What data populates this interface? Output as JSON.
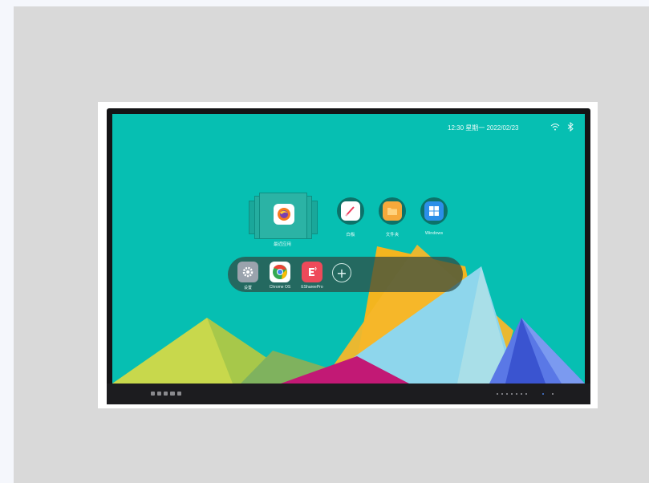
{
  "status_bar": {
    "clock": "12:30  星期一 2022/02/23",
    "icons": [
      "wifi-icon",
      "bluetooth-icon"
    ]
  },
  "apps": {
    "recent_label": "最近应用",
    "recent_app_icon": "firefox-icon",
    "items": [
      {
        "label": "白板",
        "icon": "whiteboard-icon",
        "color": "#ffffff"
      },
      {
        "label": "文件夹",
        "icon": "folder-icon",
        "color": "#f6a93b"
      },
      {
        "label": "Windows",
        "icon": "windows-icon",
        "color": "#2b8fe8"
      }
    ]
  },
  "dock": {
    "items": [
      {
        "label": "设置",
        "icon": "gear-icon",
        "color": "#9aa3ad"
      },
      {
        "label": "Chrome OS",
        "icon": "chrome-icon",
        "color": "#ffffff"
      },
      {
        "label": "EShareePro",
        "icon": "eshare-icon",
        "color": "#ee4a5a"
      }
    ],
    "add_icon": "plus-icon",
    "add_symbol": "+"
  },
  "wallpaper": {
    "background": "#06bfb2",
    "palette": [
      "#c8d84c",
      "#f3b51f",
      "#8ed6ec",
      "#c21975",
      "#5a78e6"
    ]
  }
}
